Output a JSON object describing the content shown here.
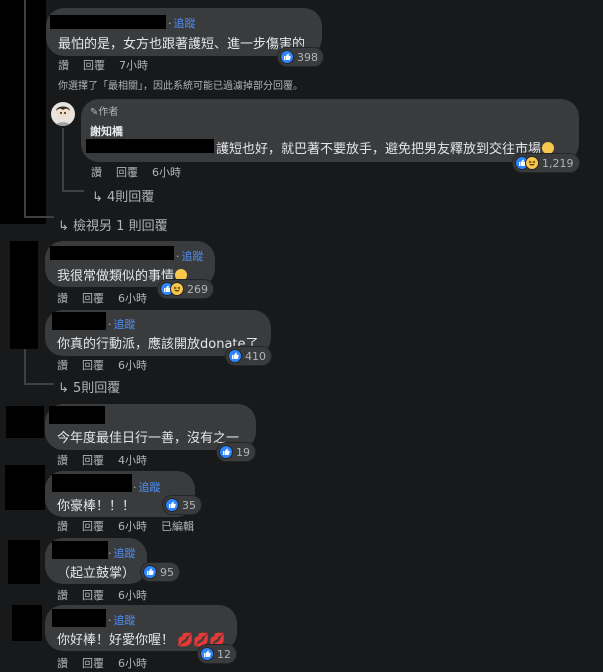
{
  "comments": [
    {
      "follow_label": "追蹤",
      "text": "最怕的是，女方也跟著護短、進一步傷害的",
      "like_label": "讚",
      "reply_label": "回覆",
      "time": "7小時",
      "reaction_count": "398",
      "filter_notice": "你選擇了「最相關」，因此系統可能已過濾掉部分回覆。"
    },
    {
      "author_badge": "作者",
      "author_name": "謝知橋",
      "text": "護短也好，就巴著不要放手，避免把男友釋放到交往市場",
      "like_label": "讚",
      "reply_label": "回覆",
      "time": "6小時",
      "reaction_count": "1,219"
    },
    {
      "follow_label": "追蹤",
      "text": "我很常做類似的事情",
      "like_label": "讚",
      "reply_label": "回覆",
      "time": "6小時",
      "reaction_count": "269"
    },
    {
      "follow_label": "追蹤",
      "text": "你真的行動派，應該開放donate了",
      "like_label": "讚",
      "reply_label": "回覆",
      "time": "6小時",
      "reaction_count": "410"
    },
    {
      "text": "今年度最佳日行一善，沒有之一",
      "like_label": "讚",
      "reply_label": "回覆",
      "time": "4小時",
      "reaction_count": "19"
    },
    {
      "follow_label": "追蹤",
      "text": "你豪棒！！！",
      "like_label": "讚",
      "reply_label": "回覆",
      "time": "6小時",
      "edited_label": "已編輯",
      "reaction_count": "35"
    },
    {
      "follow_label": "追蹤",
      "text": "（起立鼓掌）",
      "like_label": "讚",
      "reply_label": "回覆",
      "time": "6小時",
      "reaction_count": "95"
    },
    {
      "follow_label": "追蹤",
      "text": "你好棒！好愛你喔！",
      "like_label": "讚",
      "reply_label": "回覆",
      "time": "6小時",
      "reaction_count": "12"
    }
  ],
  "reply_links": {
    "four_replies": "4則回覆",
    "view_one_more": "檢視另 1 則回覆",
    "five_replies": "5則回覆"
  },
  "colors": {
    "background": "#18191a",
    "bubble": "#3a3b3c",
    "link": "#4e8ef5",
    "like": "#2d86ff"
  }
}
